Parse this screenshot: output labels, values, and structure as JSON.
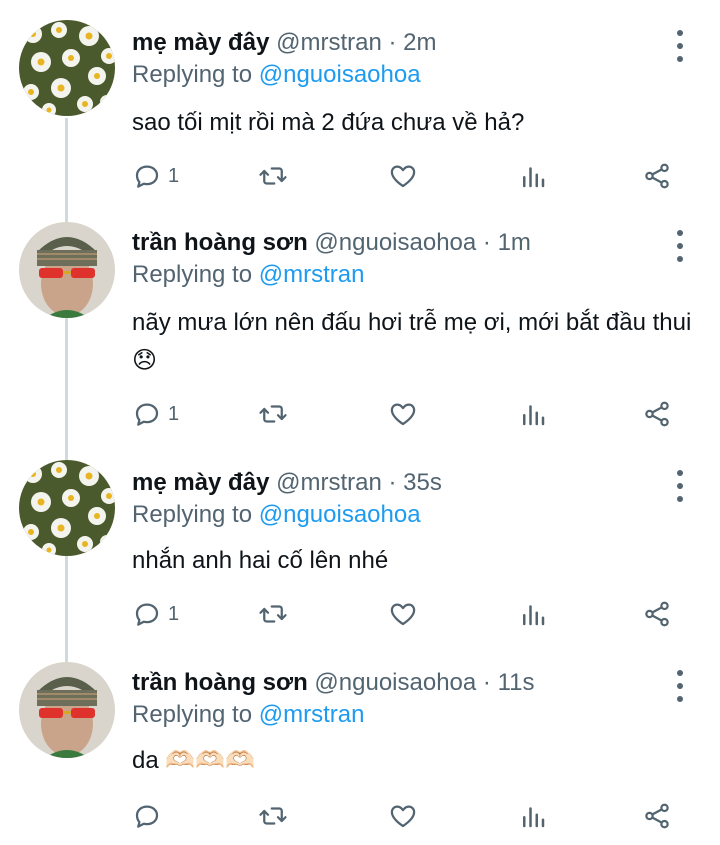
{
  "tweets": [
    {
      "name": "mẹ mày đây",
      "handle": "@mrstran",
      "time": "2m",
      "replying_prefix": "Replying to ",
      "replying_to": "@nguoisaohoa",
      "text": "sao tối mịt rồi mà 2 đứa chưa về hả?",
      "reply_count": "1",
      "avatar": "daisy-avatar"
    },
    {
      "name": "trần hoàng sơn",
      "handle": "@nguoisaohoa",
      "time": "1m",
      "replying_prefix": "Replying to ",
      "replying_to": "@mrstran",
      "text": "nãy mưa lớn nên đấu hơi trễ mẹ ơi, mới bắt đầu thui 😞",
      "reply_count": "1",
      "avatar": "person-avatar"
    },
    {
      "name": "mẹ mày đây",
      "handle": "@mrstran",
      "time": "35s",
      "replying_prefix": "Replying to ",
      "replying_to": "@nguoisaohoa",
      "text": "nhắn anh hai cố lên nhé",
      "reply_count": "1",
      "avatar": "daisy-avatar"
    },
    {
      "name": "trần hoàng sơn",
      "handle": "@nguoisaohoa",
      "time": "11s",
      "replying_prefix": "Replying to ",
      "replying_to": "@mrstran",
      "text": "da 🫶🏻🫶🏻🫶🏻",
      "reply_count": "",
      "avatar": "person-avatar"
    }
  ],
  "separator": " · ",
  "colors": {
    "link": "#1d9bf0",
    "muted": "#536471",
    "thread": "#cfd9de"
  }
}
